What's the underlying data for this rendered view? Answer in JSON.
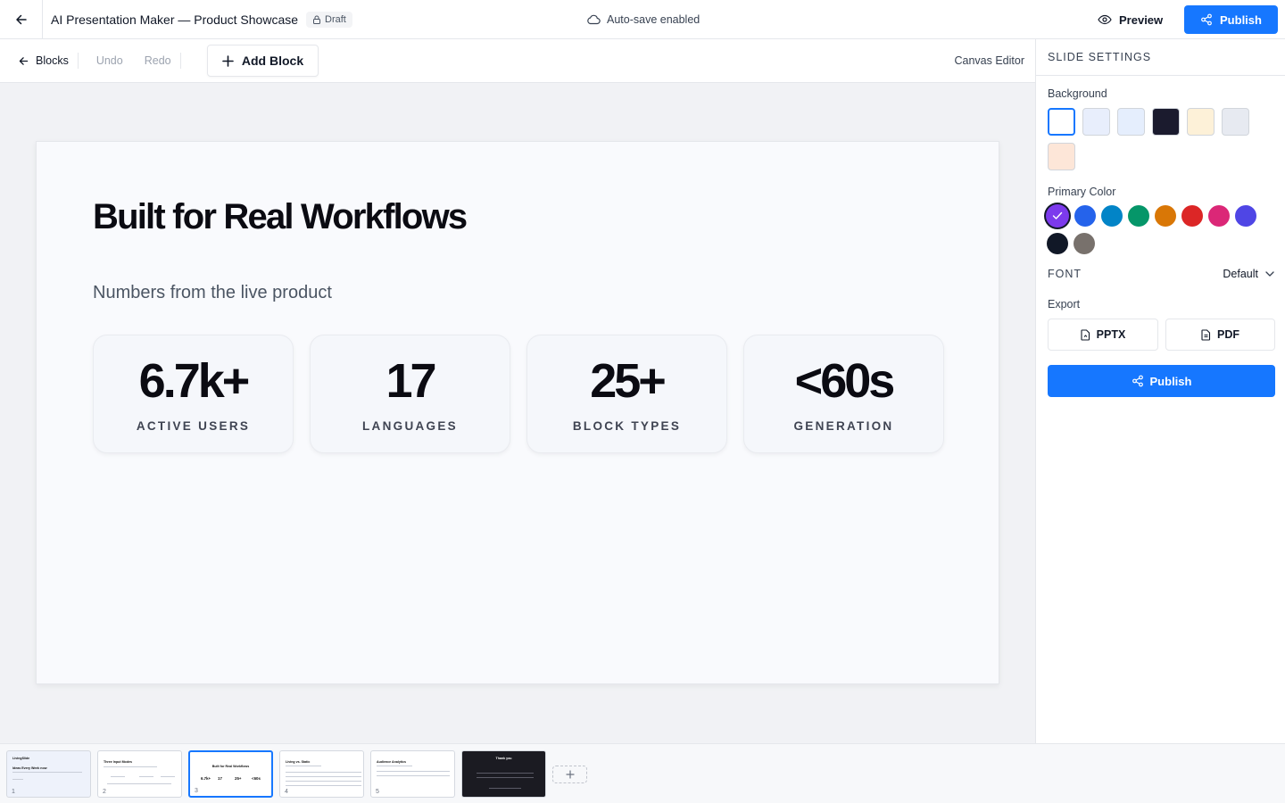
{
  "header": {
    "title": "AI Presentation Maker — Product Showcase",
    "badge": "Draft",
    "autosave": "Auto-save enabled",
    "preview_label": "Preview",
    "publish_label": "Publish"
  },
  "toolbar": {
    "blocks_label": "Blocks",
    "undo_label": "Undo",
    "redo_label": "Redo",
    "add_block_label": "Add Block",
    "mode_label": "Canvas Editor"
  },
  "slide": {
    "title": "Built for Real Workflows",
    "subtitle": "Numbers from the live product",
    "stats": [
      {
        "value": "6.7k+",
        "label": "ACTIVE USERS"
      },
      {
        "value": "17",
        "label": "LANGUAGES"
      },
      {
        "value": "25+",
        "label": "BLOCK TYPES"
      },
      {
        "value": "<60s",
        "label": "GENERATION"
      }
    ]
  },
  "sidebar": {
    "heading": "SLIDE SETTINGS",
    "background_label": "Background",
    "background_swatches": [
      "#ffffff",
      "#e8eefc",
      "#e5eefd",
      "#1b1b2e",
      "#fdf1d8",
      "#e7eaf1",
      "#fde6d8"
    ],
    "selected_background": 0,
    "primary_color_label": "Primary Color",
    "primary_colors": [
      "#7c3aed",
      "#2563eb",
      "#0284c7",
      "#059669",
      "#d97706",
      "#dc2626",
      "#db2777",
      "#4f46e5",
      "#111827",
      "#78716c"
    ],
    "selected_primary": 0,
    "font_label": "FONT",
    "font_value": "Default",
    "export_label": "Export",
    "pptx_label": "PPTX",
    "pdf_label": "PDF",
    "publish_label": "Publish"
  },
  "filmstrip": {
    "selected": 2,
    "slides": [
      {
        "num": "1",
        "title": "LivingSlide",
        "text": "Ideas Every Week now",
        "theme": "#eef2fb"
      },
      {
        "num": "2",
        "title": "Three Input Modes",
        "text": "",
        "theme": "#ffffff"
      },
      {
        "num": "3",
        "title": "Built for Real Workflows",
        "text": "",
        "theme": "#ffffff"
      },
      {
        "num": "4",
        "title": "Living vs. Static",
        "text": "",
        "theme": "#ffffff"
      },
      {
        "num": "5",
        "title": "Audience Analytics",
        "text": "",
        "theme": "#ffffff"
      },
      {
        "num": "",
        "title": "Thank you",
        "text": "",
        "theme": "#1b1b22"
      }
    ],
    "thumb_stats": [
      "6.7k+",
      "17",
      "25+",
      "<60s"
    ]
  }
}
